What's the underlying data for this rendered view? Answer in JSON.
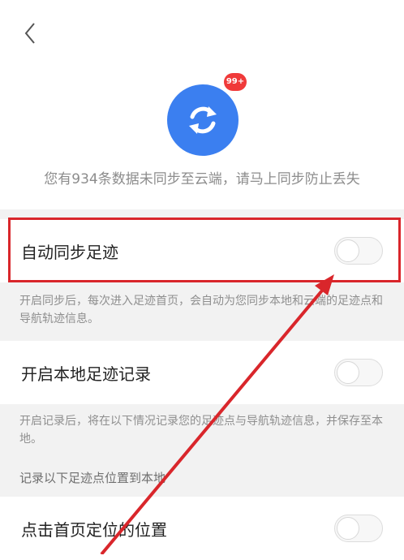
{
  "header": {
    "back_icon": "chevron-left-icon"
  },
  "sync": {
    "icon": "sync-icon",
    "badge": "99+"
  },
  "notice": "您有934条数据未同步至云端，请马上同步防止丢失",
  "settings": [
    {
      "label": "自动同步足迹",
      "enabled": false
    },
    {
      "label": "开启本地足迹记录",
      "enabled": false
    },
    {
      "label": "点击首页定位的位置",
      "enabled": false
    }
  ],
  "descriptions": [
    "开启同步后，每次进入足迹首页，会自动为您同步本地和云端的足迹点和导航轨迹信息。",
    "开启记录后，将在以下情况记录您的足迹点与导航轨迹信息，并保存至本地。"
  ],
  "section_title": "记录以下足迹点位置到本地",
  "colors": {
    "accent": "#3b7ff0",
    "badge": "#f03a3a",
    "annotation": "#d9262b"
  }
}
